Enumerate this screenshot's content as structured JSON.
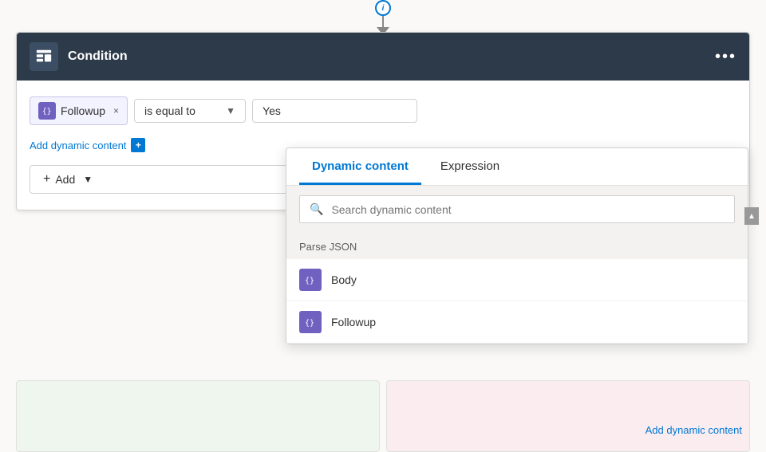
{
  "connector": {
    "icon": "i",
    "arrow": "▼"
  },
  "condition": {
    "title": "Condition",
    "more_icon": "•••",
    "token": {
      "label": "Followup",
      "close": "×"
    },
    "operator": {
      "value": "is equal to",
      "placeholder": "is equal to"
    },
    "value_input": "Yes",
    "add_dynamic_label": "Add dynamic content",
    "add_dynamic_icon": "+",
    "add_button_label": "Add",
    "add_button_icon": "+"
  },
  "dynamic_panel": {
    "tab_dynamic": "Dynamic content",
    "tab_expression": "Expression",
    "search_placeholder": "Search dynamic content",
    "search_icon": "🔍",
    "section_label": "Parse JSON",
    "items": [
      {
        "label": "Body",
        "icon": "{}"
      },
      {
        "label": "Followup",
        "icon": "{}"
      }
    ],
    "scroll_up_icon": "▲"
  }
}
